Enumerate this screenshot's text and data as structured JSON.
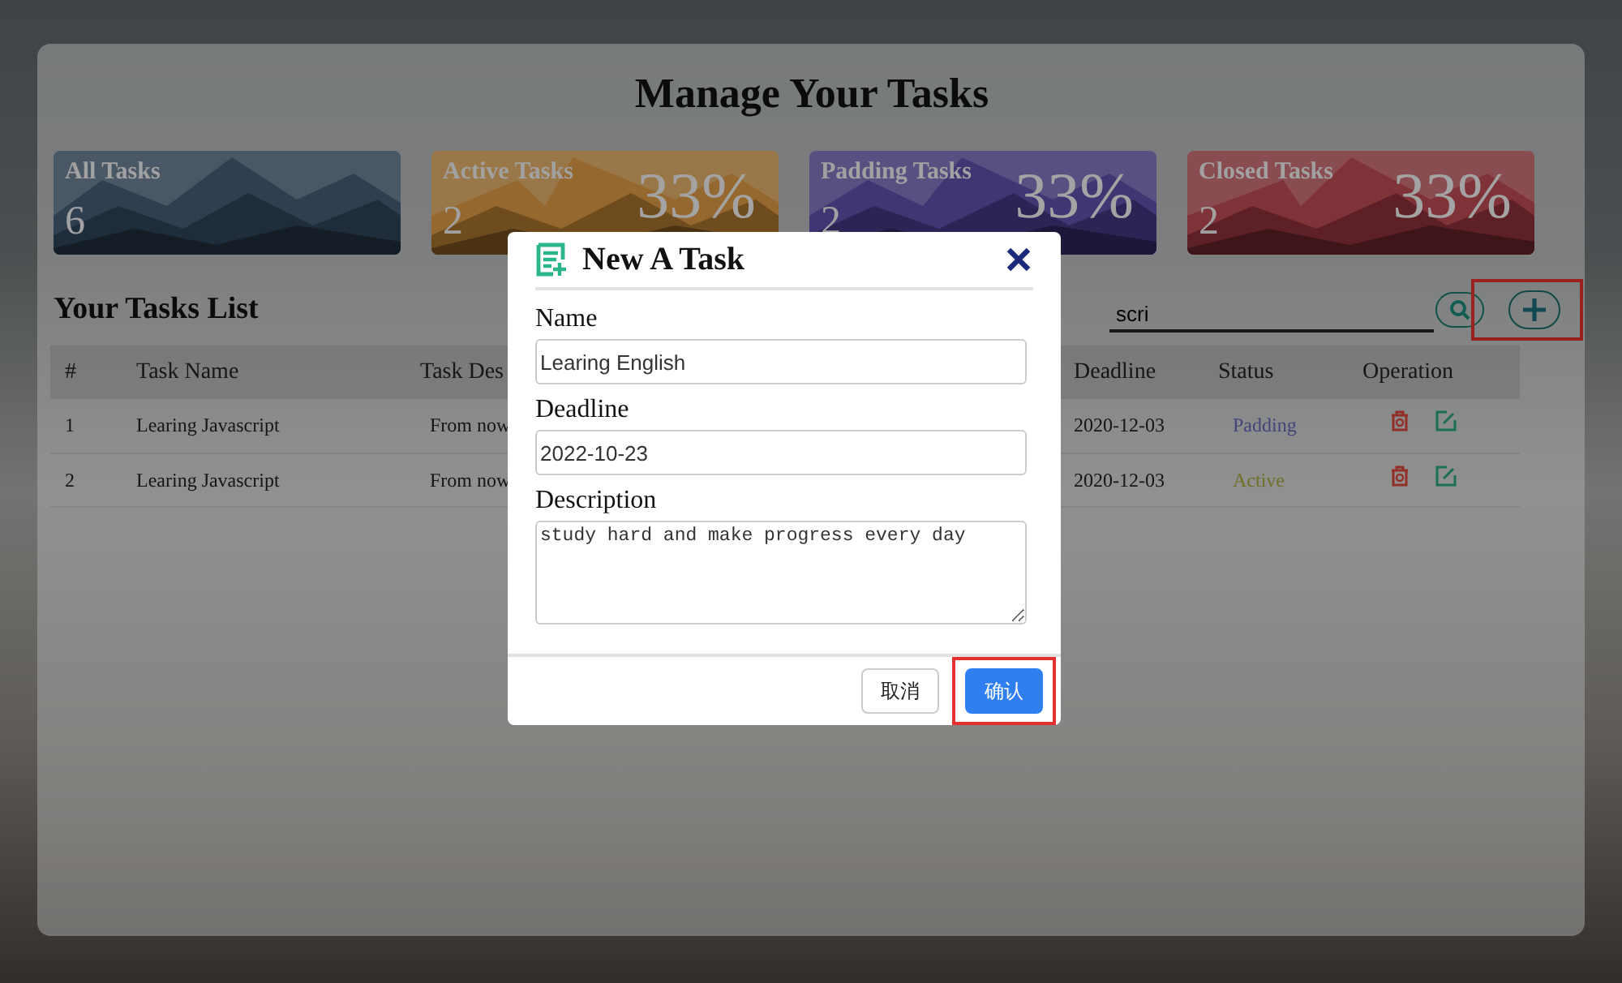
{
  "title": "Manage Your Tasks",
  "stats": [
    {
      "label": "All Tasks",
      "count": "6",
      "kind": "slate"
    },
    {
      "label": "Active Tasks",
      "count": "2",
      "percent": "33%",
      "kind": "amber"
    },
    {
      "label": "Padding Tasks",
      "count": "2",
      "percent": "33%",
      "kind": "violet"
    },
    {
      "label": "Closed Tasks",
      "count": "2",
      "percent": "33%",
      "kind": "crimson"
    }
  ],
  "list_title": "Your Tasks List",
  "search": {
    "value": "scri"
  },
  "add_button": {
    "highlighted": true
  },
  "table": {
    "columns": [
      "#",
      "Task Name",
      "Task Des",
      "Deadline",
      "Status",
      "Operation"
    ],
    "rows": [
      {
        "cells": [
          "1",
          "Learing Javascript",
          "From now",
          "2020-12-03"
        ],
        "status": {
          "text": "Padding",
          "kind": "padding"
        }
      },
      {
        "cells": [
          "2",
          "Learing Javascript",
          "From now",
          "2020-12-03"
        ],
        "status": {
          "text": "Active",
          "kind": "active"
        }
      }
    ]
  },
  "modal": {
    "title": "New A Task",
    "fields": [
      {
        "kind": "input",
        "label": "Name",
        "value": "Learing English"
      },
      {
        "kind": "input",
        "label": "Deadline",
        "value": "2022-10-23"
      },
      {
        "kind": "textarea",
        "label": "Description",
        "value": "study hard and make progress every day"
      }
    ],
    "buttons": [
      {
        "label": "取消",
        "kind": "secondary",
        "highlighted": false
      },
      {
        "label": "确认",
        "kind": "primary",
        "highlighted": true
      }
    ]
  }
}
